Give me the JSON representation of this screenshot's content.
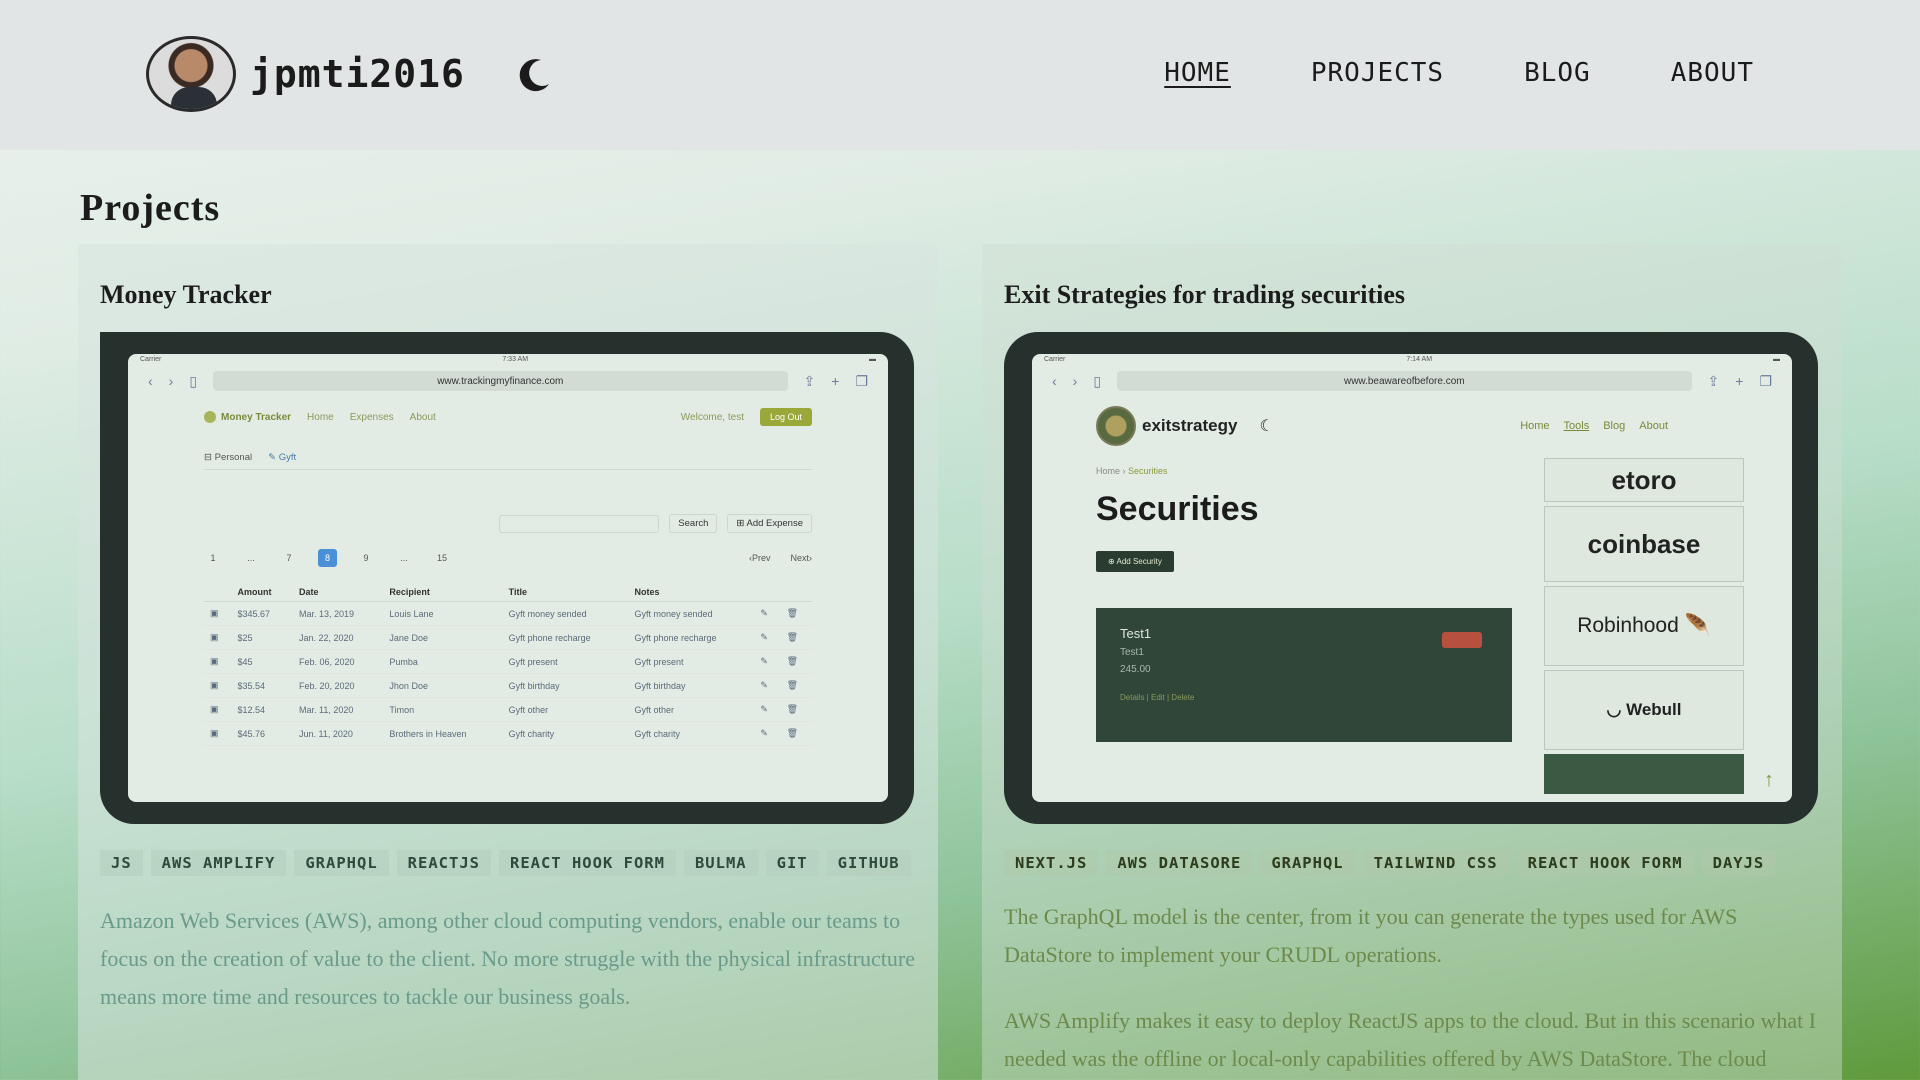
{
  "header": {
    "brand": "jpmti2016",
    "nav": [
      {
        "label": "HOME",
        "active": true
      },
      {
        "label": "PROJECTS",
        "active": false
      },
      {
        "label": "BLOG",
        "active": false
      },
      {
        "label": "ABOUT",
        "active": false
      }
    ]
  },
  "page": {
    "title": "Projects"
  },
  "projects": [
    {
      "title": "Money Tracker",
      "screenshot": {
        "carrier": "Carrier",
        "time": "7:33 AM",
        "url": "www.trackingmyfinance.com",
        "app_name": "Money Tracker",
        "nav": [
          "Home",
          "Expenses",
          "About"
        ],
        "welcome": "Welcome, test",
        "logout": "Log Out",
        "tabs": [
          "Personal",
          "Gyft"
        ],
        "search_btn": "Search",
        "add_btn": "Add Expense",
        "pages": [
          "1",
          "...",
          "7",
          "8",
          "9",
          "...",
          "15"
        ],
        "prev": "‹Prev",
        "next": "Next›",
        "columns": [
          "Amount",
          "Date",
          "Recipient",
          "Title",
          "Notes"
        ],
        "rows": [
          [
            "$345.67",
            "Mar. 13, 2019",
            "Louis Lane",
            "Gyft money sended",
            "Gyft money sended"
          ],
          [
            "$25",
            "Jan. 22, 2020",
            "Jane Doe",
            "Gyft phone recharge",
            "Gyft phone recharge"
          ],
          [
            "$45",
            "Feb. 06, 2020",
            "Pumba",
            "Gyft present",
            "Gyft present"
          ],
          [
            "$35.54",
            "Feb. 20, 2020",
            "Jhon Doe",
            "Gyft birthday",
            "Gyft birthday"
          ],
          [
            "$12.54",
            "Mar. 11, 2020",
            "Timon",
            "Gyft other",
            "Gyft other"
          ],
          [
            "$45.76",
            "Jun. 11, 2020",
            "Brothers in Heaven",
            "Gyft charity",
            "Gyft charity"
          ]
        ]
      },
      "tags": [
        "JS",
        "AWS AMPLIFY",
        "GRAPHQL",
        "REACTJS",
        "REACT HOOK FORM",
        "BULMA",
        "GIT",
        "GITHUB"
      ],
      "description": [
        "Amazon Web Services (AWS), among other cloud computing vendors, enable our teams to focus on the creation of value to the client. No more struggle with the physical infrastructure means more time and resources to tackle our business goals."
      ]
    },
    {
      "title": "Exit Strategies for trading securities",
      "screenshot": {
        "carrier": "Carrier",
        "time": "7:14 AM",
        "url": "www.beawareofbefore.com",
        "app_name": "exitstrategy",
        "nav": [
          "Home",
          "Tools",
          "Blog",
          "About"
        ],
        "breadcrumb": [
          "Home",
          "Securities"
        ],
        "heading": "Securities",
        "add_btn": "Add Security",
        "card": {
          "title": "Test1",
          "subtitle": "Test1",
          "amount": "245.00",
          "links": "Details | Edit | Delete"
        },
        "brokers": [
          "etoro",
          "coinbase",
          "Robinhood",
          "Webull"
        ]
      },
      "tags": [
        "NEXT.JS",
        "AWS DATASORE",
        "GRAPHQL",
        "TAILWIND CSS",
        "REACT HOOK FORM",
        "DAYJS"
      ],
      "description": [
        "The GraphQL model is the center, from it you can generate the types used for AWS DataStore to implement your CRUDL operations.",
        "AWS Amplify makes it easy to deploy ReactJS apps to the cloud. But in this scenario what I needed was the offline or local-only capabilities offered by AWS DataStore. The cloud persistence is at one push distance."
      ]
    }
  ]
}
